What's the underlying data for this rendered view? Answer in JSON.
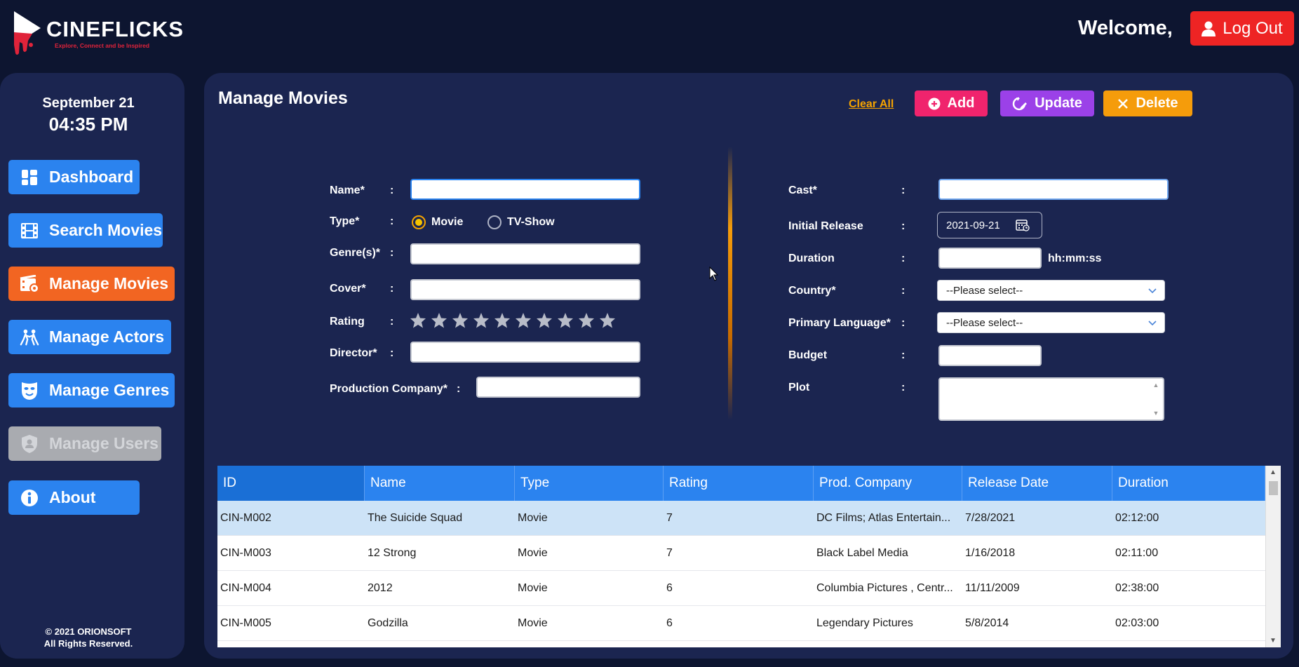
{
  "header": {
    "logo_title": "CINEFLICKS",
    "logo_tagline": "Explore, Connect and be Inspired",
    "welcome": "Welcome,",
    "logout_label": "Log Out"
  },
  "sidebar": {
    "date": "September 21",
    "time": "04:35 PM",
    "items": [
      {
        "label": "Dashboard",
        "icon": "dashboard-icon"
      },
      {
        "label": "Search Movies",
        "icon": "film-icon"
      },
      {
        "label": "Manage Movies",
        "icon": "film-settings-icon",
        "active": true
      },
      {
        "label": "Manage Actors",
        "icon": "actors-icon"
      },
      {
        "label": "Manage Genres",
        "icon": "mask-icon"
      },
      {
        "label": "Manage Users",
        "icon": "user-shield-icon",
        "disabled": true
      },
      {
        "label": "About",
        "icon": "info-icon"
      }
    ],
    "copyright_line1": "© 2021 ORIONSOFT",
    "copyright_line2": "All Rights Reserved."
  },
  "main": {
    "title": "Manage Movies",
    "clear_all": "Clear All",
    "add_label": "Add",
    "update_label": "Update",
    "delete_label": "Delete"
  },
  "form": {
    "name_label": "Name*",
    "type_label": "Type*",
    "type_movie": "Movie",
    "type_tvshow": "TV-Show",
    "type_selected": "Movie",
    "genres_label": "Genre(s)*",
    "cover_label": "Cover*",
    "rating_label": "Rating",
    "rating_value": 0,
    "rating_max": 10,
    "director_label": "Director*",
    "production_label": "Production Company*",
    "cast_label": "Cast*",
    "release_label": "Initial Release",
    "release_value": "2021-09-21",
    "duration_label": "Duration",
    "duration_hint": "hh:mm:ss",
    "country_label": "Country*",
    "country_value": "--Please select--",
    "language_label": "Primary Language*",
    "language_value": "--Please select--",
    "budget_label": "Budget",
    "plot_label": "Plot",
    "colon": ":"
  },
  "table": {
    "columns": [
      "ID",
      "Name",
      "Type",
      "Rating",
      "Prod. Company",
      "Release Date",
      "Duration"
    ],
    "rows": [
      [
        "CIN-M002",
        "The Suicide Squad",
        "Movie",
        "7",
        "DC Films; Atlas Entertain...",
        "7/28/2021",
        "02:12:00"
      ],
      [
        "CIN-M003",
        "12 Strong",
        "Movie",
        "7",
        "Black Label Media",
        "1/16/2018",
        "02:11:00"
      ],
      [
        "CIN-M004",
        "2012",
        "Movie",
        "6",
        "Columbia Pictures , Centr...",
        "11/11/2009",
        "02:38:00"
      ],
      [
        "CIN-M005",
        "Godzilla",
        "Movie",
        "6",
        "Legendary Pictures",
        "5/8/2014",
        "02:03:00"
      ]
    ],
    "selected_row": 0
  },
  "colors": {
    "background": "#0d1530",
    "panel": "#1b2550",
    "nav_blue": "#2b83ef",
    "nav_active": "#f26522",
    "logout_red": "#ee2424",
    "add_pink": "#f0246d",
    "update_purple": "#9b41e8",
    "delete_orange": "#f59c0b"
  }
}
